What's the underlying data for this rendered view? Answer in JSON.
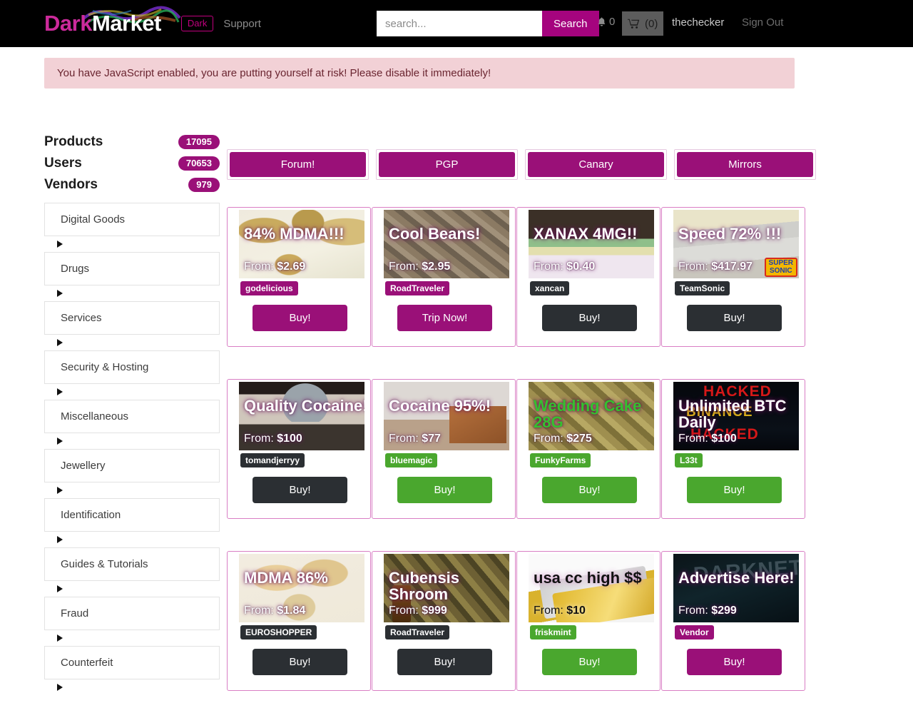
{
  "header": {
    "brand_dark": "Dark",
    "brand_market": "Market",
    "dark_pill": "Dark",
    "support": "Support",
    "search_placeholder": "search...",
    "search_value": "",
    "search_button": "Search",
    "notifications_count": "0",
    "cart_count": "(0)",
    "username": "thechecker",
    "signout": "Sign Out"
  },
  "warning": {
    "text": "You have JavaScript enabled, you are putting yourself at risk! Please disable it immediately!"
  },
  "sidebar": {
    "stats": [
      {
        "label": "Products",
        "count": "17095"
      },
      {
        "label": "Users",
        "count": "70653"
      },
      {
        "label": "Vendors",
        "count": "979"
      }
    ],
    "categories": [
      "Digital Goods",
      "Drugs",
      "Services",
      "Security & Hosting",
      "Miscellaneous",
      "Jewellery",
      "Identification",
      "Guides & Tutorials",
      "Fraud",
      "Counterfeit"
    ]
  },
  "nav_buttons": [
    {
      "label": "Forum!"
    },
    {
      "label": "PGP"
    },
    {
      "label": "Canary"
    },
    {
      "label": "Mirrors"
    }
  ],
  "products": [
    [
      {
        "title": "84% MDMA!!!",
        "from_label": "From:",
        "price": "$2.69",
        "vendor": "godelicious",
        "vendor_style": "v-purple",
        "buy_label": "Buy!",
        "buy_style": "b-purple",
        "art": "art-mdma84",
        "title_style": ""
      },
      {
        "title": "Cool Beans!",
        "from_label": "From:",
        "price": "$2.95",
        "vendor": "RoadTraveler",
        "vendor_style": "v-purple",
        "buy_label": "Trip Now!",
        "buy_style": "b-purple",
        "art": "art-beans",
        "title_style": ""
      },
      {
        "title": "XANAX 4MG!!",
        "from_label": "From:",
        "price": "$0.40",
        "vendor": "xancan",
        "vendor_style": "v-dark",
        "buy_label": "Buy!",
        "buy_style": "b-dark",
        "art": "art-xanax",
        "title_style": ""
      },
      {
        "title": "Speed 72% !!!",
        "from_label": "From:",
        "price": "$417.97",
        "vendor": "TeamSonic",
        "vendor_style": "v-dark",
        "buy_label": "Buy!",
        "buy_style": "b-dark",
        "art": "art-speed",
        "title_style": ""
      }
    ],
    [
      {
        "title": "Quality Cocaine!",
        "from_label": "From:",
        "price": "$100",
        "vendor": "tomandjerryy",
        "vendor_style": "v-dark",
        "buy_label": "Buy!",
        "buy_style": "b-dark",
        "art": "art-qcocaine",
        "title_style": ""
      },
      {
        "title": "Cocaine 95%!",
        "from_label": "From:",
        "price": "$77",
        "vendor": "bluemagic",
        "vendor_style": "v-green",
        "buy_label": "Buy!",
        "buy_style": "b-green",
        "art": "art-cocaine95",
        "title_style": ""
      },
      {
        "title": "Wedding Cake 28G",
        "from_label": "From:",
        "price": "$275",
        "vendor": "FunkyFarms",
        "vendor_style": "v-green",
        "buy_label": "Buy!",
        "buy_style": "b-green",
        "art": "art-wcake",
        "title_style": "green"
      },
      {
        "title": "Unlimited BTC Daily",
        "from_label": "From:",
        "price": "$100",
        "vendor": "L33t",
        "vendor_style": "v-green",
        "buy_label": "Buy!",
        "buy_style": "b-green",
        "art": "art-btc",
        "title_style": ""
      }
    ],
    [
      {
        "title": "MDMA 86%",
        "from_label": "From:",
        "price": "$1.84",
        "vendor": "EUROSHOPPER",
        "vendor_style": "v-dark",
        "buy_label": "Buy!",
        "buy_style": "b-dark",
        "art": "art-mdma86",
        "title_style": ""
      },
      {
        "title": "Cubensis Shroom",
        "from_label": "From:",
        "price": "$999",
        "vendor": "RoadTraveler",
        "vendor_style": "v-dark",
        "buy_label": "Buy!",
        "buy_style": "b-dark",
        "art": "art-cubensis",
        "title_style": ""
      },
      {
        "title": "usa cc high $$",
        "from_label": "From:",
        "price": "$10",
        "vendor": "friskmint",
        "vendor_style": "v-green",
        "buy_label": "Buy!",
        "buy_style": "b-green",
        "art": "art-cc",
        "title_style": "dark"
      },
      {
        "title": "Advertise Here!",
        "from_label": "From:",
        "price": "$299",
        "vendor": "Vendor",
        "vendor_style": "v-purple",
        "buy_label": "Buy!",
        "buy_style": "b-purple",
        "art": "art-advert",
        "title_style": ""
      }
    ]
  ],
  "icons": {
    "bell": "bell-icon",
    "cart": "cart-icon"
  },
  "colors": {
    "accent_purple": "#9a1078",
    "accent_green": "#4aa72e",
    "accent_dark": "#2b2f33",
    "card_border": "#d97ec4",
    "warning_bg": "#f2d1d6"
  }
}
